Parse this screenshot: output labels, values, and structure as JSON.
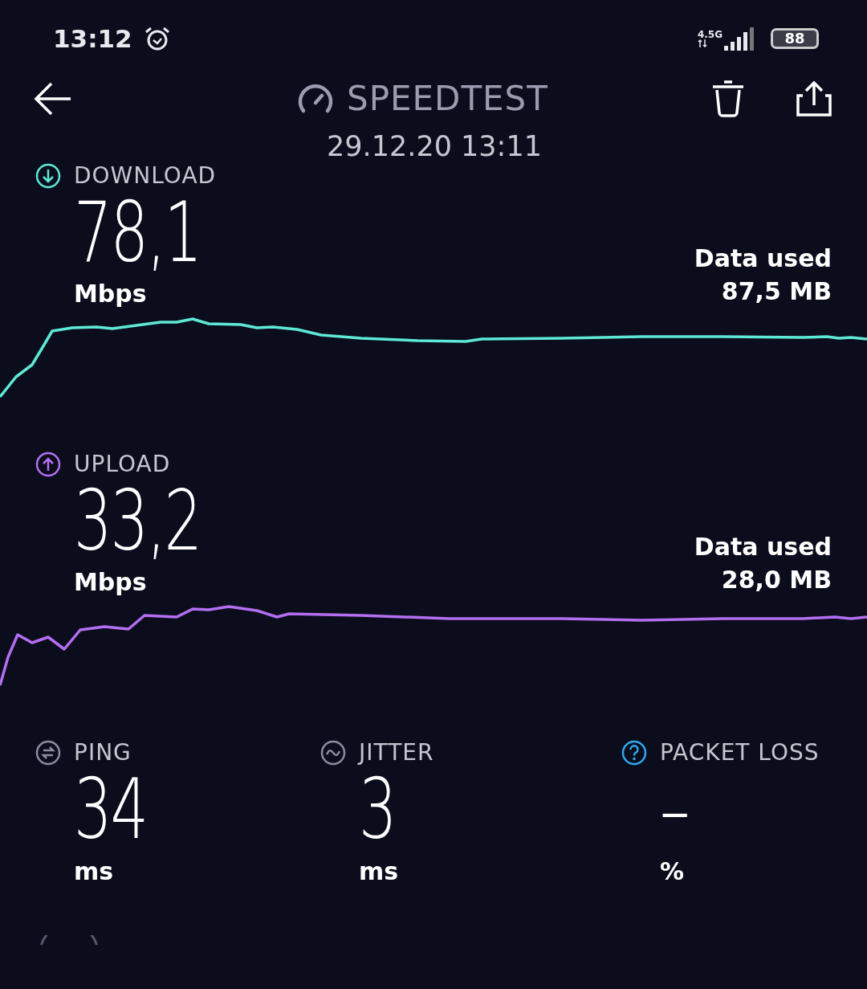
{
  "status_bar": {
    "time": "13:12",
    "network": "4.5G",
    "battery": "88"
  },
  "header": {
    "title": "SPEEDTEST",
    "date": "29.12.20 13:11"
  },
  "tests": [
    {
      "kind": "download",
      "label": "DOWNLOAD",
      "value": "78,1",
      "unit": "Mbps",
      "data_used_label": "Data used",
      "data_used_value": "87,5 MB",
      "color": "#5ee8d6"
    },
    {
      "kind": "upload",
      "label": "UPLOAD",
      "value": "33,2",
      "unit": "Mbps",
      "data_used_label": "Data used",
      "data_used_value": "28,0 MB",
      "color": "#b46ef2"
    }
  ],
  "metrics": [
    {
      "kind": "ping",
      "label": "PING",
      "value": "34",
      "unit": "ms"
    },
    {
      "kind": "jitter",
      "label": "JITTER",
      "value": "3",
      "unit": "ms"
    },
    {
      "kind": "packet_loss",
      "label": "PACKET LOSS",
      "value": "–",
      "unit": "%"
    }
  ]
}
